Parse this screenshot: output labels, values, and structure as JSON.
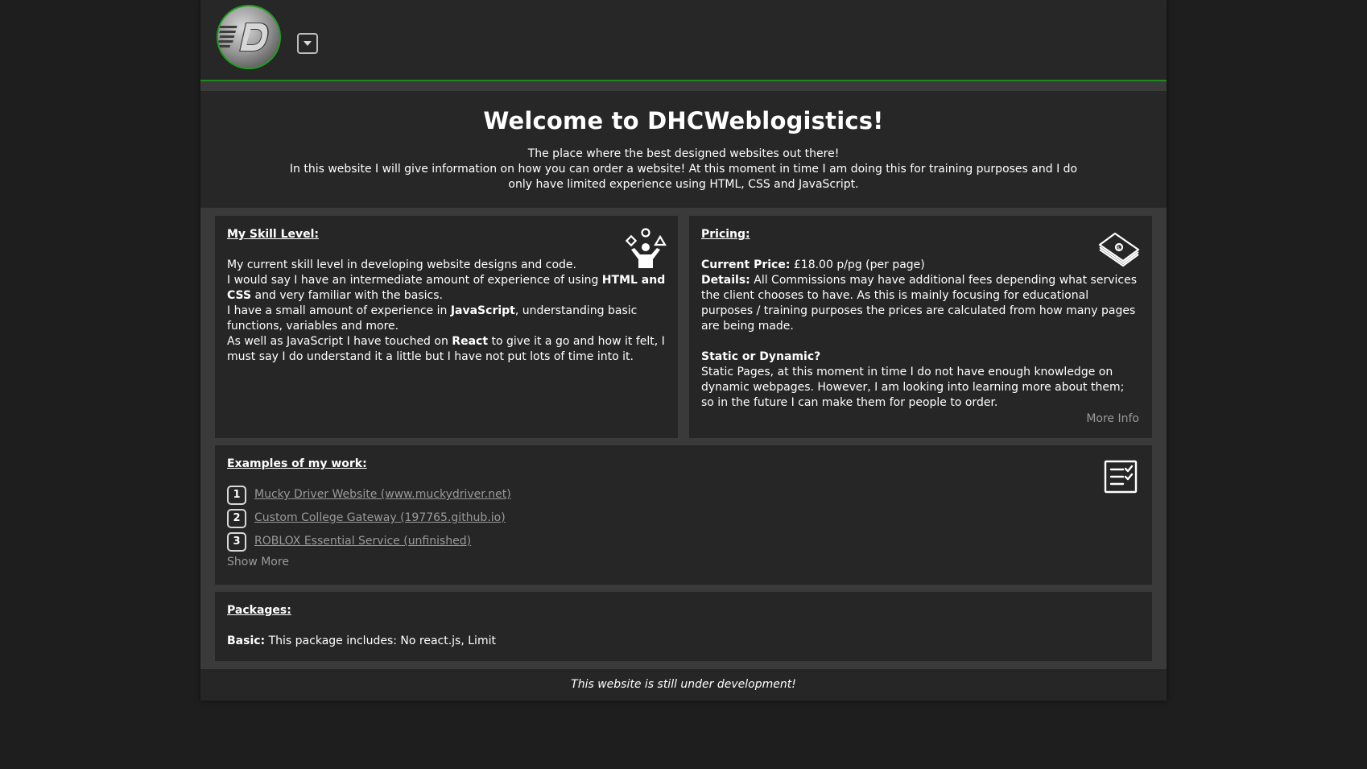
{
  "header": {
    "logo_letter": "D",
    "menu_icon": "chevron-down-icon"
  },
  "hero": {
    "title": "Welcome to DHCWeblogistics!",
    "line1": "The place where the best designed websites out there!",
    "line2": "In this website I will give information on how you can order a website! At this moment in time I am doing this for training purposes and I do only have limited experience using HTML, CSS and JavaScript."
  },
  "skill": {
    "title": "My Skill Level:",
    "icon": "juggler-icon",
    "p1": "My current skill level in developing website designs and code.",
    "p2_a": "I would say I have an intermediate amount of experience of using ",
    "p2_b": "HTML and CSS",
    "p2_c": " and very familiar with the basics.",
    "p3_a": "I have a small amount of experience in ",
    "p3_b": "JavaScript",
    "p3_c": ", understanding basic functions, variables and more.",
    "p4_a": "As well as JavaScript I have touched on ",
    "p4_b": "React",
    "p4_c": " to give it a go and how it felt, I must say I do understand it a little but I have not put lots of time into it."
  },
  "pricing": {
    "title": "Pricing:",
    "icon": "money-stack-icon",
    "price_label": "Current Price:",
    "price_value": " £18.00 p/pg (per page)",
    "details_label": "Details:",
    "details_value": " All Commissions may have additional fees depending what services the client chooses to have. As this is mainly focusing for educational purposes / training purposes the prices are calculated from how many pages are being made.",
    "static_title": "Static or Dynamic?",
    "static_text": "Static Pages, at this moment in time I do not have enough knowledge on dynamic webpages. However, I am looking into learning more about them; so in the future I can make them for people to order.",
    "more_info": "More Info"
  },
  "examples": {
    "title": "Examples of my work:",
    "icon": "checklist-icon",
    "items": [
      {
        "num": "1",
        "label": "Mucky Driver Website (www.muckydriver.net)"
      },
      {
        "num": "2",
        "label": "Custom College Gateway (197765.github.io)"
      },
      {
        "num": "3",
        "label": "ROBLOX Essential Service (unfinished)"
      }
    ],
    "show_more": "Show More"
  },
  "packages": {
    "title": "Packages:",
    "basic_label": "Basic:",
    "basic_value": " This package includes: No react.js, Limit"
  },
  "footer": {
    "text": "This website is still under development!"
  },
  "colors": {
    "accent_green": "#1f8a1f",
    "page_bg": "#1e1e1e",
    "panel_bg": "#262626",
    "link_gray": "#9a9a9a"
  }
}
